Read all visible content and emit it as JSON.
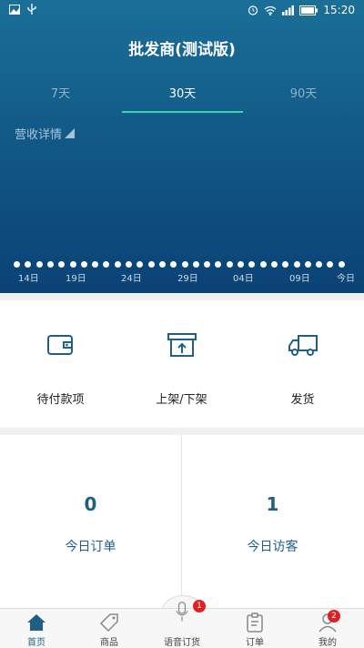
{
  "statusbar": {
    "time": "15:20"
  },
  "header": {
    "title": "批发商(测试版)"
  },
  "tabs": [
    {
      "label": "7天",
      "active": false
    },
    {
      "label": "30天",
      "active": true
    },
    {
      "label": "90天",
      "active": false
    }
  ],
  "revenue": {
    "label": "营收详情"
  },
  "timeline": {
    "labels": [
      "14日",
      "19日",
      "24日",
      "29日",
      "04日",
      "09日",
      "今日"
    ]
  },
  "actions": [
    {
      "label": "待付款项",
      "icon": "wallet-icon"
    },
    {
      "label": "上架/下架",
      "icon": "box-upload-icon"
    },
    {
      "label": "发货",
      "icon": "truck-icon"
    }
  ],
  "stats": [
    {
      "value": "0",
      "label": "今日订单"
    },
    {
      "value": "1",
      "label": "今日访客"
    }
  ],
  "nav": [
    {
      "label": "首页",
      "icon": "home-icon",
      "active": true
    },
    {
      "label": "商品",
      "icon": "tag-icon"
    },
    {
      "label": "语音订货",
      "icon": "microphone-icon",
      "badge": "1"
    },
    {
      "label": "订单",
      "icon": "clipboard-icon"
    },
    {
      "label": "我的",
      "icon": "user-icon",
      "badge": "2"
    }
  ],
  "colors": {
    "accent": "#3fd3a8",
    "primary": "#1f5f86",
    "badge": "#e02020"
  }
}
